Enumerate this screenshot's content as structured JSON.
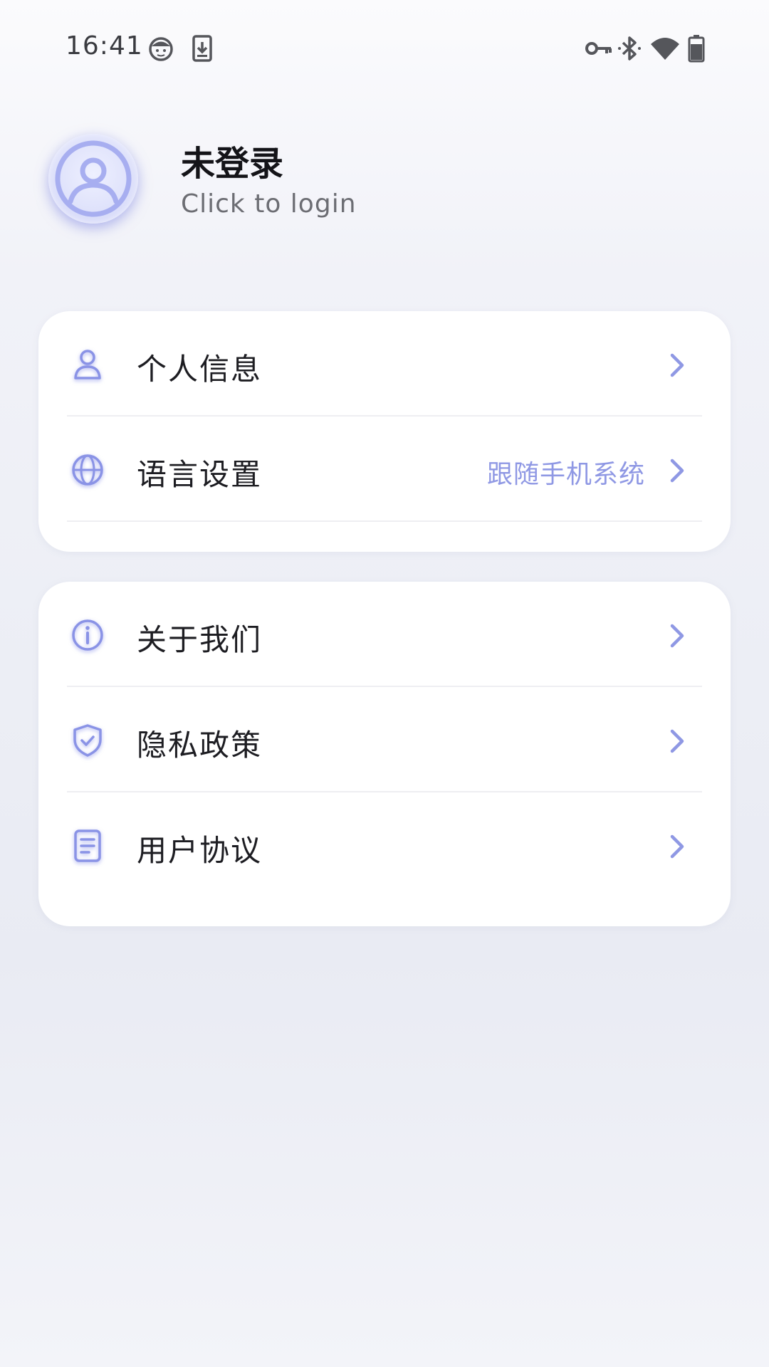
{
  "status_bar": {
    "time": "16:41",
    "left_icons": [
      "face-notification-icon",
      "download-icon"
    ],
    "right_icons": [
      "vpn-key-icon",
      "bluetooth-icon",
      "wifi-icon",
      "battery-icon"
    ]
  },
  "profile": {
    "name": "未登录",
    "subtitle": "Click to login",
    "avatar_icon": "user-avatar-icon"
  },
  "settings_group": {
    "items": [
      {
        "label": "个人信息",
        "icon": "person-icon",
        "value": ""
      },
      {
        "label": "语言设置",
        "icon": "globe-icon",
        "value": "跟随手机系统"
      }
    ]
  },
  "info_group": {
    "items": [
      {
        "label": "关于我们",
        "icon": "info-icon"
      },
      {
        "label": "隐私政策",
        "icon": "shield-check-icon"
      },
      {
        "label": "用户协议",
        "icon": "document-icon"
      }
    ]
  },
  "colors": {
    "accent": "#8f98e4",
    "icon_stroke": "#8a93e6",
    "text_primary": "#1d1d22",
    "text_secondary": "#6c6d73"
  }
}
